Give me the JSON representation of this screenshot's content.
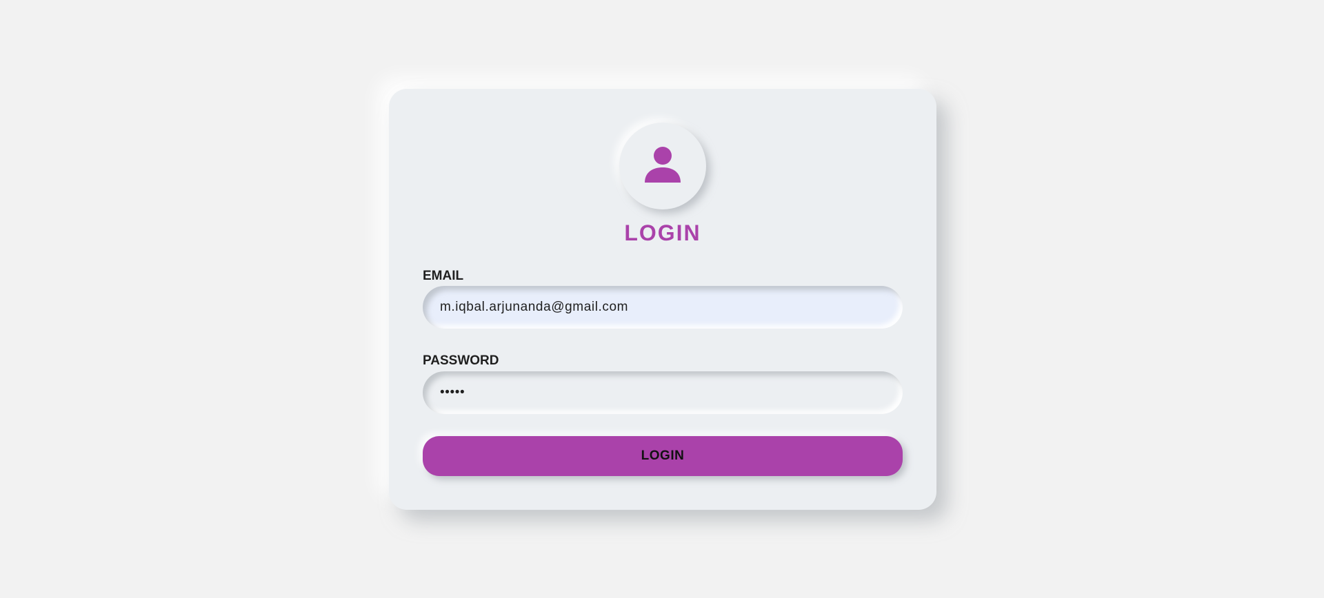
{
  "theme": {
    "accent": "#aa42aa",
    "background": "#f2f2f2",
    "card": "#eceff2"
  },
  "login_card": {
    "avatar_icon": "user-icon",
    "title": "LOGIN",
    "email": {
      "label": "EMAIL",
      "value": "m.iqbal.arjunanda@gmail.com"
    },
    "password": {
      "label": "PASSWORD",
      "value": "•••••"
    },
    "submit_label": "LOGIN"
  }
}
